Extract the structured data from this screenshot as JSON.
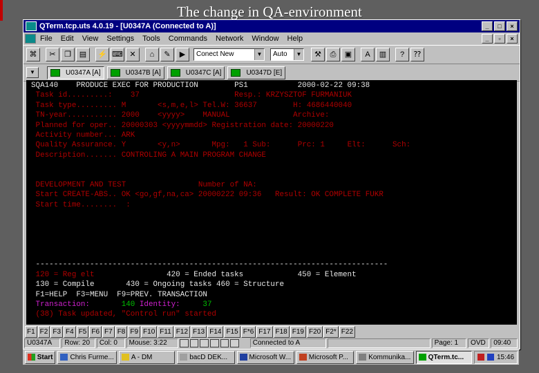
{
  "slide_title": "The change in QA-environment",
  "window": {
    "title": "QTerm.tcp.uts 4.0.19 - [U0347A (Connected to A)]",
    "minimize_icon": "minimize-icon",
    "maximize_icon": "maximize-icon",
    "close_icon": "close-icon"
  },
  "menu": [
    "File",
    "Edit",
    "View",
    "Settings",
    "Tools",
    "Commands",
    "Network",
    "Window",
    "Help"
  ],
  "toolbar": {
    "session_combo": "Conect New",
    "mode_combo": "Auto"
  },
  "session_tabs": [
    {
      "label": "U0347A [A]",
      "active": true
    },
    {
      "label": "U0347B [A]",
      "active": false
    },
    {
      "label": "U0347C [A]",
      "active": false
    },
    {
      "label": "U0347D [E]",
      "active": false
    }
  ],
  "terminal": {
    "header_id": "SQA140",
    "header_title": "PRODUCE EXEC FOR PRODUCTION",
    "header_code": "PS1",
    "header_datetime": "2000-02-22 09:38",
    "task_id_label": "Task id.........:",
    "task_id": "37",
    "resp_label": "Resp.:",
    "resp": "KRZYSZTOF FURMANIUK",
    "task_type_label": "Task type.........",
    "task_type": "M",
    "task_type_hint": "<s,m,e,l>",
    "tel_label": "Tel.W:",
    "tel": "36637",
    "h_label": "H:",
    "h_phone": "4686440040",
    "tn_year_label": "TN-year...........",
    "tn_year": "2000",
    "tn_year_hint": "<yyyy>",
    "manual": "MANUAL",
    "archive_label": "Archive:",
    "planned_label": "Planned for oper..",
    "planned": "20000303",
    "planned_hint": "<yyyymmdd>",
    "regdate_label": "Registration date:",
    "regdate": "20000220",
    "activity_label": "Activity number...",
    "activity": "ARK",
    "qa_label": "Quality Assurance.",
    "qa": "Y",
    "qa_hint": "<y,n>",
    "mpg_label": "Mpg:",
    "mpg": "1",
    "sub_label": "Sub:",
    "prc_label": "Prc:",
    "prc": "1",
    "elt_label": "Elt:",
    "sch_label": "Sch:",
    "desc_label": "Description.......",
    "desc": "CONTROLING A MAIN PROGRAM CHANGE",
    "dev_test": "DEVELOPMENT AND TEST",
    "num_na_label": "Number of NA:",
    "start_create_label": "Start CREATE-ABS..",
    "start_create": "OK",
    "start_create_hint": "<go,gf,na,ca>",
    "start_create_time": "20000222 09:36",
    "result_label": "Result:",
    "result": "OK COMPLETE FUKR",
    "start_time_label": "Start time........",
    "start_time_colon": ":",
    "separator": "------------------------------------------------------------------------------",
    "legend_120": "120 = Reg elt",
    "legend_420": "420 = Ended tasks",
    "legend_450": "450 = Element",
    "legend_130": "130 = Compile",
    "legend_430": "430 = Ongoing tasks",
    "legend_460": "460 = Structure",
    "help_keys": "F1=HELP  F3=MENU  F9=PREV. TRANSACTION",
    "transaction_label": "Transaction:",
    "transaction": "140",
    "identity_label": "Identity:",
    "identity": "37",
    "message": "(38) Task updated, \"Control run\" started"
  },
  "fkeys": [
    "F1",
    "F2",
    "F3",
    "F4",
    "F5",
    "F6",
    "F7",
    "F8",
    "F9",
    "F10",
    "F11",
    "F12",
    "F13",
    "F14",
    "F15",
    "F*6",
    "F17",
    "F18",
    "F19",
    "F20",
    "F2*",
    "F22"
  ],
  "status": {
    "session": "U0347A",
    "row": "Row: 20",
    "col": "Col: 0",
    "mouse": "Mouse: 3:22",
    "connection": "Connected to A",
    "page": "Page: 1",
    "ovr": "OVD",
    "time": "09:40"
  },
  "taskbar": {
    "start": "Start",
    "items": [
      "Chris Furme...",
      "A - DM",
      "bacD DEK...",
      "Microsoft W...",
      "Microsoft P...",
      "Kommunika...",
      "QTerm.tc..."
    ],
    "active_index": 6,
    "clock": "15:46"
  },
  "colors": {
    "titlebar": "#000080",
    "terminal_bg": "#000000",
    "terminal_text": "#e8e8e8",
    "terminal_green": "#00c000",
    "terminal_magenta": "#d020d0",
    "terminal_red": "#b00000"
  }
}
